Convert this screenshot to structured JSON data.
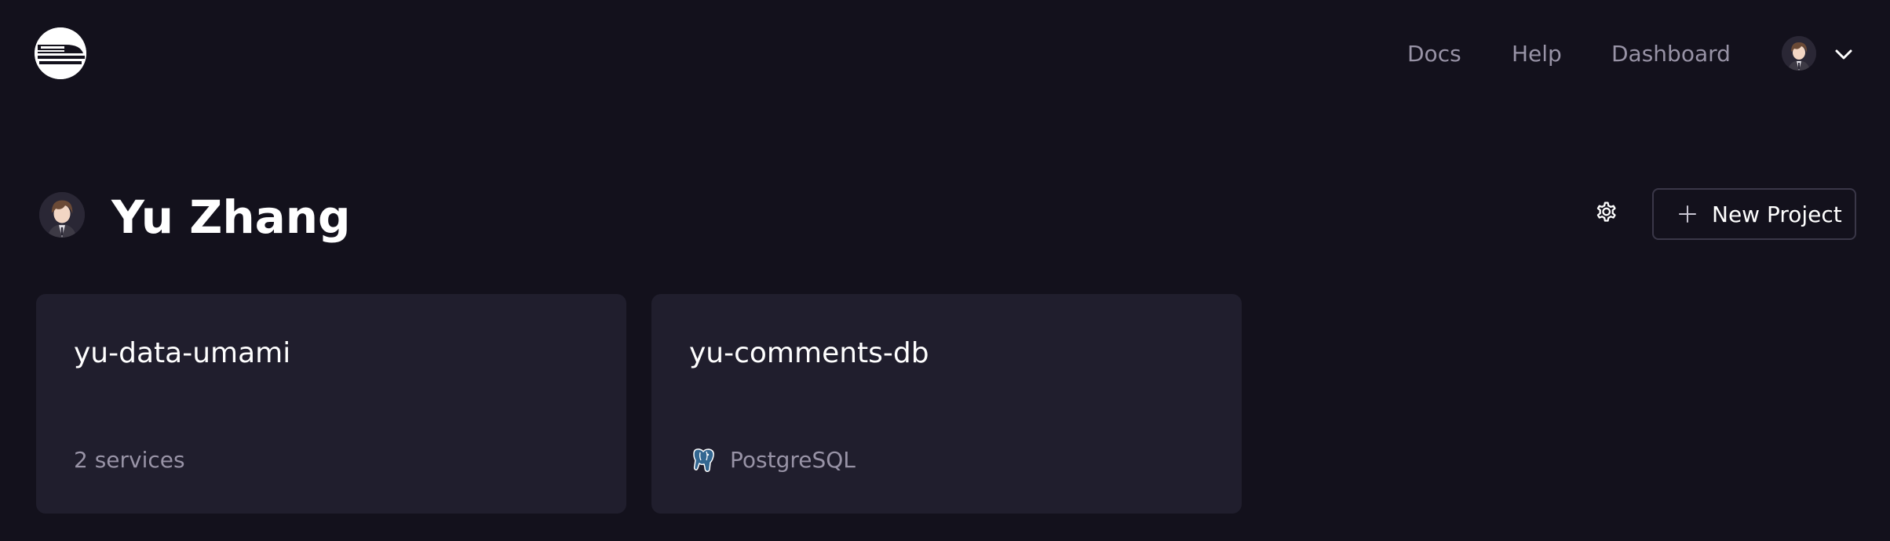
{
  "header": {
    "logo_icon": "railway-train-logo",
    "nav": [
      {
        "label": "Docs"
      },
      {
        "label": "Help"
      },
      {
        "label": "Dashboard"
      }
    ],
    "user_menu": {
      "avatar_icon": "user-avatar",
      "chevron_icon": "chevron-down-icon"
    }
  },
  "profile": {
    "name": "Yu Zhang",
    "avatar_icon": "user-avatar",
    "settings_icon": "gear-icon",
    "new_project_label": "New Project",
    "new_project_icon": "plus-icon"
  },
  "projects": [
    {
      "name": "yu-data-umami",
      "meta": "2 services"
    },
    {
      "name": "yu-comments-db",
      "meta": "PostgreSQL",
      "meta_icon": "postgresql-icon"
    }
  ],
  "colors": {
    "background": "#13111c",
    "card": "#201e2d",
    "muted_text": "#9893a6",
    "border": "#3a3748"
  }
}
